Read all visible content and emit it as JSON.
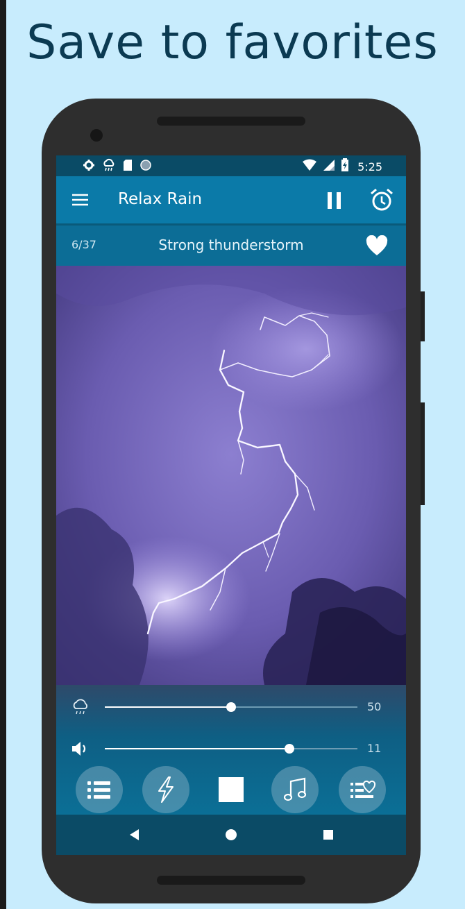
{
  "headline": "Save to favorites",
  "status_bar": {
    "time": "5:25",
    "left_icons": [
      "settings-icon",
      "rain-cloud-icon",
      "sd-card-icon",
      "circle-icon"
    ],
    "right_icons": [
      "wifi-icon",
      "signal-icon",
      "battery-icon"
    ]
  },
  "app_bar": {
    "title": "Relax Rain",
    "menu_icon": "hamburger-menu-icon",
    "pause_icon": "pause-icon",
    "alarm_icon": "alarm-clock-icon"
  },
  "track": {
    "counter": "6/37",
    "name": "Strong thunderstorm",
    "favorite_icon": "heart-icon"
  },
  "sliders": {
    "rain": {
      "icon": "rain-cloud-icon",
      "value": "50",
      "level_percent": 50
    },
    "volume": {
      "icon": "speaker-icon",
      "value": "11",
      "level_percent": 73
    }
  },
  "bottom_buttons": [
    "list-icon",
    "lightning-icon",
    "stop-icon",
    "music-note-icon",
    "favorites-list-icon"
  ],
  "nav_bar": [
    "back-icon",
    "home-icon",
    "recents-icon"
  ],
  "colors": {
    "background": "#c8ecfd",
    "headline": "#0b3a52",
    "app_bar": "#0b7aa8",
    "track_bar": "#0c6d96",
    "status_bar": "#0a4b66"
  }
}
